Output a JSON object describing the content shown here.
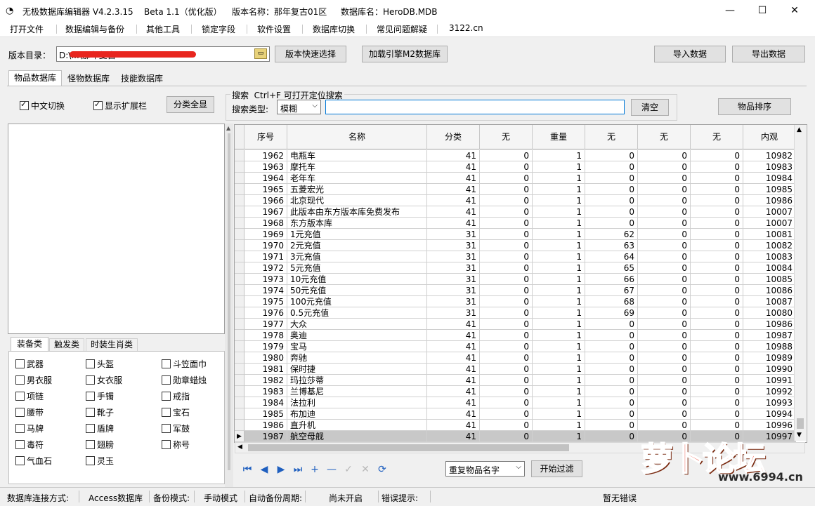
{
  "window": {
    "app_title": "无极数据库编辑器 V4.2.3.15",
    "edition": "Beta 1.1（优化版）",
    "version_name": "版本名称：那年复古01区",
    "db_name": "数据库名：HeroDB.MDB",
    "minimize": "—",
    "maximize": "☐",
    "close": "✕"
  },
  "menu": [
    "打开文件",
    "数据编辑与备份",
    "其他工具",
    "锁定字段",
    "软件设置",
    "数据库切换",
    "常见问题解疑",
    "3122.cn"
  ],
  "toolbar": {
    "dir_label": "版本目录：",
    "dir_value": "D:\\...\\那年复古",
    "quick_select": "版本快速选择",
    "load_m2": "加载引擎M2数据库",
    "import": "导入数据",
    "export": "导出数据"
  },
  "tabs": [
    "物品数据库",
    "怪物数据库",
    "技能数据库"
  ],
  "options": {
    "cn_switch": "中文切换",
    "show_ext": "显示扩展栏",
    "show_all": "分类全显",
    "search_group": "搜索  Ctrl+F 可打开定位搜索",
    "search_type_label": "搜索类型:",
    "search_type_value": "模糊",
    "search_value": "",
    "clear": "清空",
    "sort": "物品排序"
  },
  "category_tabs": [
    "装备类",
    "触发类",
    "时装生肖类"
  ],
  "category_items": [
    [
      "武器",
      "头盔",
      "斗笠面巾"
    ],
    [
      "男衣服",
      "女衣服",
      "勋章蜡烛"
    ],
    [
      "项链",
      "手镯",
      "戒指"
    ],
    [
      "腰带",
      "靴子",
      "宝石"
    ],
    [
      "马牌",
      "盾牌",
      "军鼓"
    ],
    [
      "毒符",
      "翅膀",
      "称号"
    ],
    [
      "气血石",
      "灵玉",
      ""
    ]
  ],
  "table": {
    "columns": [
      "序号",
      "名称",
      "分类",
      "无",
      "重量",
      "无",
      "无",
      "无",
      "内观"
    ],
    "rows": [
      [
        "1962",
        "电瓶车",
        "41",
        "0",
        "1",
        "0",
        "0",
        "0",
        "10982"
      ],
      [
        "1963",
        "摩托车",
        "41",
        "0",
        "1",
        "0",
        "0",
        "0",
        "10983"
      ],
      [
        "1964",
        "老年车",
        "41",
        "0",
        "1",
        "0",
        "0",
        "0",
        "10984"
      ],
      [
        "1965",
        "五菱宏光",
        "41",
        "0",
        "1",
        "0",
        "0",
        "0",
        "10985"
      ],
      [
        "1966",
        "北京现代",
        "41",
        "0",
        "1",
        "0",
        "0",
        "0",
        "10986"
      ],
      [
        "1967",
        "此版本由东方版本库免费发布",
        "41",
        "0",
        "1",
        "0",
        "0",
        "0",
        "10007"
      ],
      [
        "1968",
        "东方版本库",
        "41",
        "0",
        "1",
        "0",
        "0",
        "0",
        "10007"
      ],
      [
        "1969",
        "1元充值",
        "31",
        "0",
        "1",
        "62",
        "0",
        "0",
        "10081"
      ],
      [
        "1970",
        "2元充值",
        "31",
        "0",
        "1",
        "63",
        "0",
        "0",
        "10082"
      ],
      [
        "1971",
        "3元充值",
        "31",
        "0",
        "1",
        "64",
        "0",
        "0",
        "10083"
      ],
      [
        "1972",
        "5元充值",
        "31",
        "0",
        "1",
        "65",
        "0",
        "0",
        "10084"
      ],
      [
        "1973",
        "10元充值",
        "31",
        "0",
        "1",
        "66",
        "0",
        "0",
        "10085"
      ],
      [
        "1974",
        "50元充值",
        "31",
        "0",
        "1",
        "67",
        "0",
        "0",
        "10086"
      ],
      [
        "1975",
        "100元充值",
        "31",
        "0",
        "1",
        "68",
        "0",
        "0",
        "10087"
      ],
      [
        "1976",
        "0.5元充值",
        "31",
        "0",
        "1",
        "69",
        "0",
        "0",
        "10080"
      ],
      [
        "1977",
        "大众",
        "41",
        "0",
        "1",
        "0",
        "0",
        "0",
        "10986"
      ],
      [
        "1978",
        "奥迪",
        "41",
        "0",
        "1",
        "0",
        "0",
        "0",
        "10987"
      ],
      [
        "1979",
        "宝马",
        "41",
        "0",
        "1",
        "0",
        "0",
        "0",
        "10988"
      ],
      [
        "1980",
        "奔驰",
        "41",
        "0",
        "1",
        "0",
        "0",
        "0",
        "10989"
      ],
      [
        "1981",
        "保时捷",
        "41",
        "0",
        "1",
        "0",
        "0",
        "0",
        "10990"
      ],
      [
        "1982",
        "玛拉莎蒂",
        "41",
        "0",
        "1",
        "0",
        "0",
        "0",
        "10991"
      ],
      [
        "1983",
        "兰博基尼",
        "41",
        "0",
        "1",
        "0",
        "0",
        "0",
        "10992"
      ],
      [
        "1984",
        "法拉利",
        "41",
        "0",
        "1",
        "0",
        "0",
        "0",
        "10993"
      ],
      [
        "1985",
        "布加迪",
        "41",
        "0",
        "1",
        "0",
        "0",
        "0",
        "10994"
      ],
      [
        "1986",
        "直升机",
        "41",
        "0",
        "1",
        "0",
        "0",
        "0",
        "10996"
      ],
      [
        "1987",
        "航空母舰",
        "41",
        "0",
        "1",
        "0",
        "0",
        "0",
        "10997"
      ]
    ]
  },
  "bottom": {
    "filter_select": "重复物品名字",
    "start_filter": "开始过滤",
    "nav": [
      "⏮",
      "◀",
      "▶",
      "⏭",
      "+",
      "—",
      "✓",
      "✕",
      "⟳"
    ]
  },
  "status": {
    "conn_label": "数据库连接方式:",
    "conn_value": "Access数据库",
    "backup_label": "备份模式:",
    "backup_value": "手动模式",
    "auto_label": "自动备份周期:",
    "auto_value": "尚未开启",
    "err_label": "错误提示:",
    "err_value": "暂无错误"
  },
  "watermark": {
    "logo": "萝卜论坛",
    "url": "www.6994.cn"
  }
}
